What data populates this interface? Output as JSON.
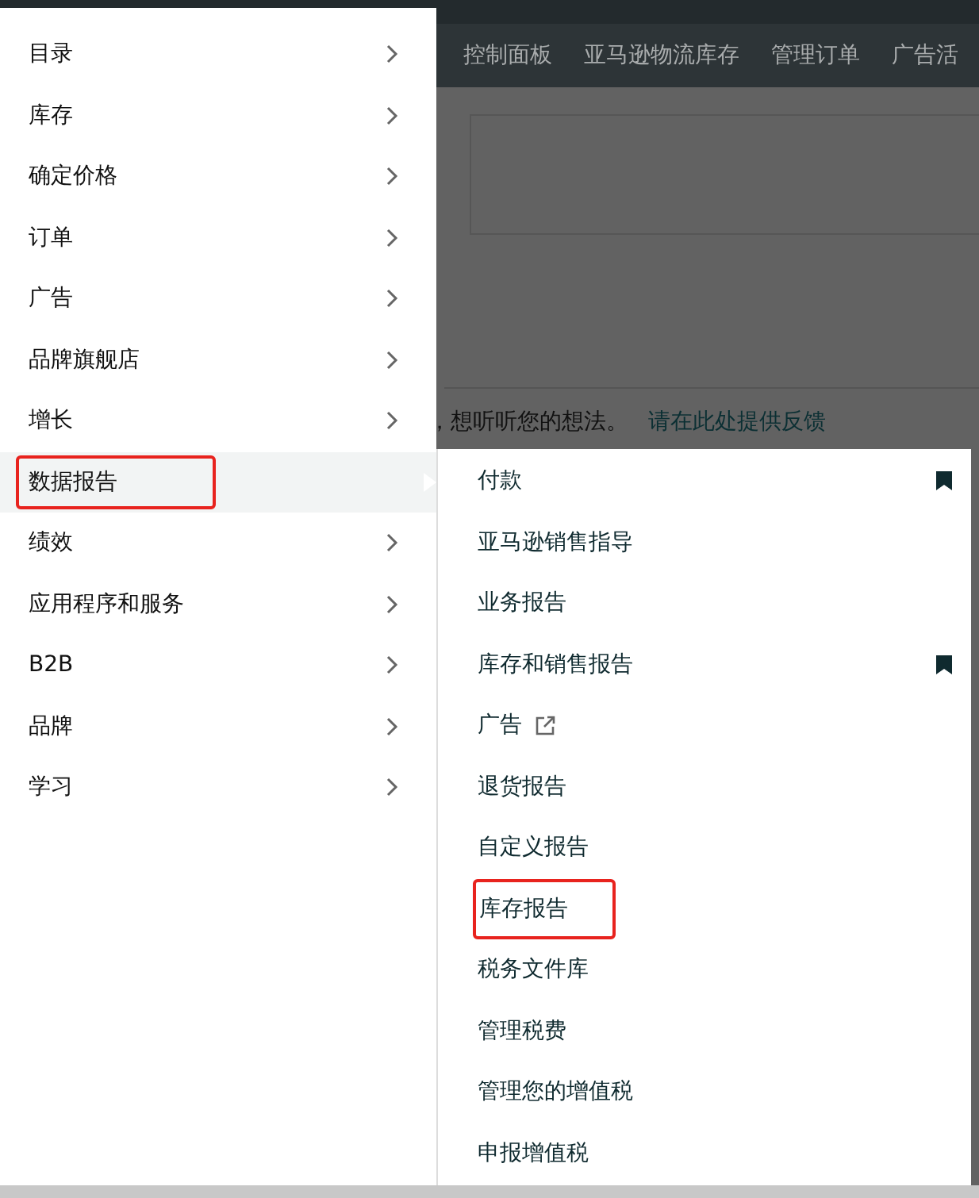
{
  "nav": {
    "items": [
      "控制面板",
      "亚马逊物流库存",
      "管理订单",
      "广告活"
    ]
  },
  "feedback": {
    "text": "，想听听您的想法。",
    "link": "请在此处提供反馈"
  },
  "menu": {
    "items": [
      {
        "label": "目录",
        "selected": false,
        "annotated": false
      },
      {
        "label": "库存",
        "selected": false,
        "annotated": false
      },
      {
        "label": "确定价格",
        "selected": false,
        "annotated": false
      },
      {
        "label": "订单",
        "selected": false,
        "annotated": false
      },
      {
        "label": "广告",
        "selected": false,
        "annotated": false
      },
      {
        "label": "品牌旗舰店",
        "selected": false,
        "annotated": false
      },
      {
        "label": "增长",
        "selected": false,
        "annotated": false
      },
      {
        "label": "数据报告",
        "selected": true,
        "annotated": true
      },
      {
        "label": "绩效",
        "selected": false,
        "annotated": false
      },
      {
        "label": "应用程序和服务",
        "selected": false,
        "annotated": false
      },
      {
        "label": "B2B",
        "selected": false,
        "annotated": false
      },
      {
        "label": "品牌",
        "selected": false,
        "annotated": false
      },
      {
        "label": "学习",
        "selected": false,
        "annotated": false
      }
    ]
  },
  "submenu": {
    "items": [
      {
        "label": "付款",
        "bookmarked": true,
        "external": false,
        "annotated": false
      },
      {
        "label": "亚马逊销售指导",
        "bookmarked": false,
        "external": false,
        "annotated": false
      },
      {
        "label": "业务报告",
        "bookmarked": false,
        "external": false,
        "annotated": false
      },
      {
        "label": "库存和销售报告",
        "bookmarked": true,
        "external": false,
        "annotated": false
      },
      {
        "label": "广告",
        "bookmarked": false,
        "external": true,
        "annotated": false
      },
      {
        "label": "退货报告",
        "bookmarked": false,
        "external": false,
        "annotated": false
      },
      {
        "label": "自定义报告",
        "bookmarked": false,
        "external": false,
        "annotated": false
      },
      {
        "label": "库存报告",
        "bookmarked": false,
        "external": false,
        "annotated": true
      },
      {
        "label": "税务文件库",
        "bookmarked": false,
        "external": false,
        "annotated": false
      },
      {
        "label": "管理税费",
        "bookmarked": false,
        "external": false,
        "annotated": false
      },
      {
        "label": "管理您的增值税",
        "bookmarked": false,
        "external": false,
        "annotated": false
      },
      {
        "label": "申报增值税",
        "bookmarked": false,
        "external": false,
        "annotated": false
      }
    ]
  }
}
